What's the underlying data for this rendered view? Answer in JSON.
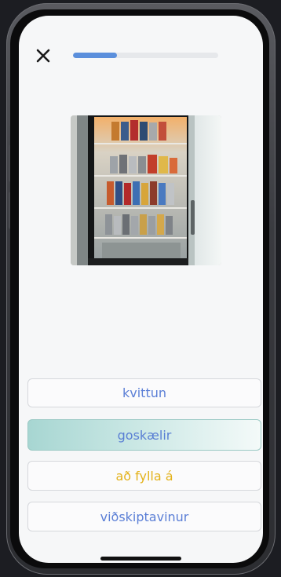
{
  "progress": {
    "value": 0.3
  },
  "image": {
    "alt": ""
  },
  "options": [
    {
      "label": "kvittun"
    },
    {
      "label": "goskælir"
    },
    {
      "label": "að fylla á"
    },
    {
      "label": "viðskiptavinur"
    }
  ],
  "icons": {
    "close": "close-icon"
  },
  "colors": {
    "accent": "#5b8fdc",
    "option_text": "#5b7fd6",
    "highlight_text": "#e3b21a",
    "selected_bg": "#a7d6d2"
  }
}
